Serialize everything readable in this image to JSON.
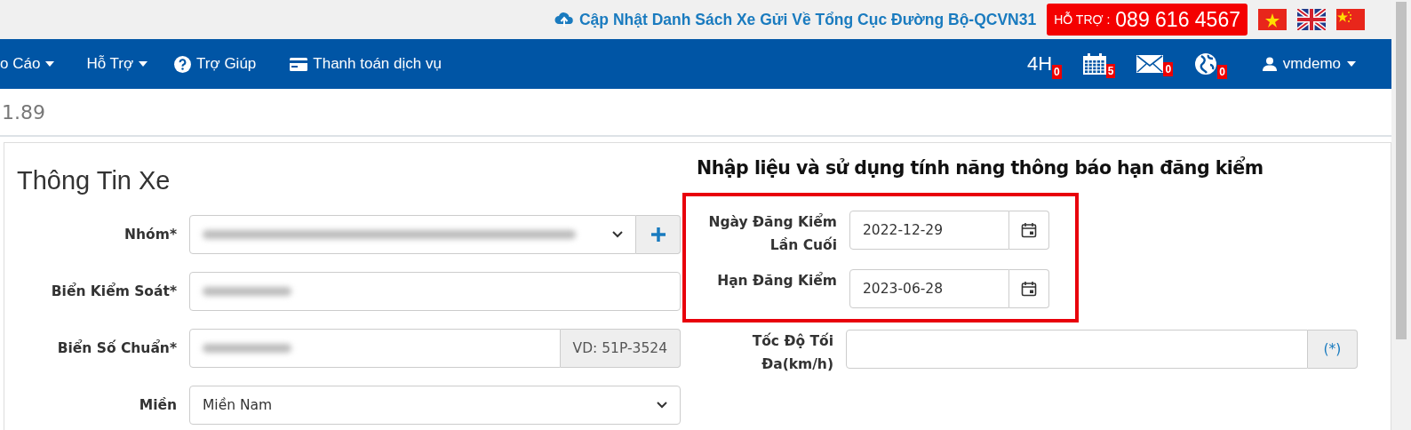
{
  "top_bar": {
    "update_link": "Cập Nhật Danh Sách Xe Gửi Về Tổng Cục Đường Bộ-QCVN31",
    "support_label": "HỖ TRỢ :",
    "support_phone": "089 616 4567",
    "flags": [
      {
        "kind": "vn"
      },
      {
        "kind": "uk"
      },
      {
        "kind": "cn"
      }
    ]
  },
  "nav": {
    "items": [
      {
        "label": "o Cáo",
        "kind": "dropdown"
      },
      {
        "label": "Hỗ Trợ",
        "kind": "dropdown"
      },
      {
        "label": "Trợ Giúp",
        "kind": "help"
      },
      {
        "label": "Thanh toán dịch vụ",
        "kind": "card"
      }
    ],
    "counters": [
      {
        "kind": "text",
        "label": "4H",
        "count": "0"
      },
      {
        "kind": "calendar",
        "count": "5"
      },
      {
        "kind": "mail",
        "count": "0"
      },
      {
        "kind": "globe",
        "count": "0"
      }
    ],
    "user": "vmdemo"
  },
  "breadcrumb": "1.89",
  "vehicle_info": {
    "title": "Thông Tin Xe",
    "fields": [
      {
        "label": "Nhóm*",
        "kind": "select-add",
        "blurred": true
      },
      {
        "label": "Biển Kiểm Soát*",
        "kind": "text",
        "blurred": true
      },
      {
        "label": "Biển Số Chuẩn*",
        "kind": "addon",
        "blurred": true,
        "addon": "VD: 51P-3524"
      },
      {
        "label": "Miền",
        "kind": "select",
        "value": "Miền Nam"
      }
    ]
  },
  "inspection": {
    "heading": "Nhập liệu và sử dụng tính năng thông báo hạn đăng kiểm",
    "highlighted_fields": [
      {
        "label": "Ngày Đăng Kiểm Lần Cuối",
        "value": "2022-12-29"
      },
      {
        "label": "Hạn Đăng Kiểm",
        "value": "2023-06-28"
      }
    ],
    "fields": [
      {
        "label": "Tốc Độ Tối Đa(km/h)",
        "addon": "(*)"
      }
    ]
  }
}
